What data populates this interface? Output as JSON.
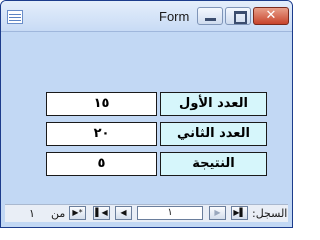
{
  "window": {
    "title": "Form",
    "close_glyph": "✕"
  },
  "form": {
    "rows": [
      {
        "label": "العدد الأول",
        "value": "١٥"
      },
      {
        "label": "العدد الثاني",
        "value": "٢٠"
      },
      {
        "label": "النتيجة",
        "value": "٥"
      }
    ]
  },
  "navigator": {
    "record_label": "السجل:",
    "current_record": "١",
    "of_label": "من",
    "total_records": "١",
    "first_glyph": "▶▌",
    "prev_glyph": "▶",
    "next_glyph": "◀",
    "last_glyph": "▌◀",
    "new_glyph": "▶*",
    "icons": [
      "first-record-icon",
      "previous-record-icon",
      "next-record-icon",
      "last-record-icon",
      "new-record-icon"
    ]
  },
  "colors": {
    "form_background": "#c2d8f4",
    "label_background": "#d6f6fb",
    "value_background": "#ffffff",
    "close_button": "#c8442c"
  }
}
